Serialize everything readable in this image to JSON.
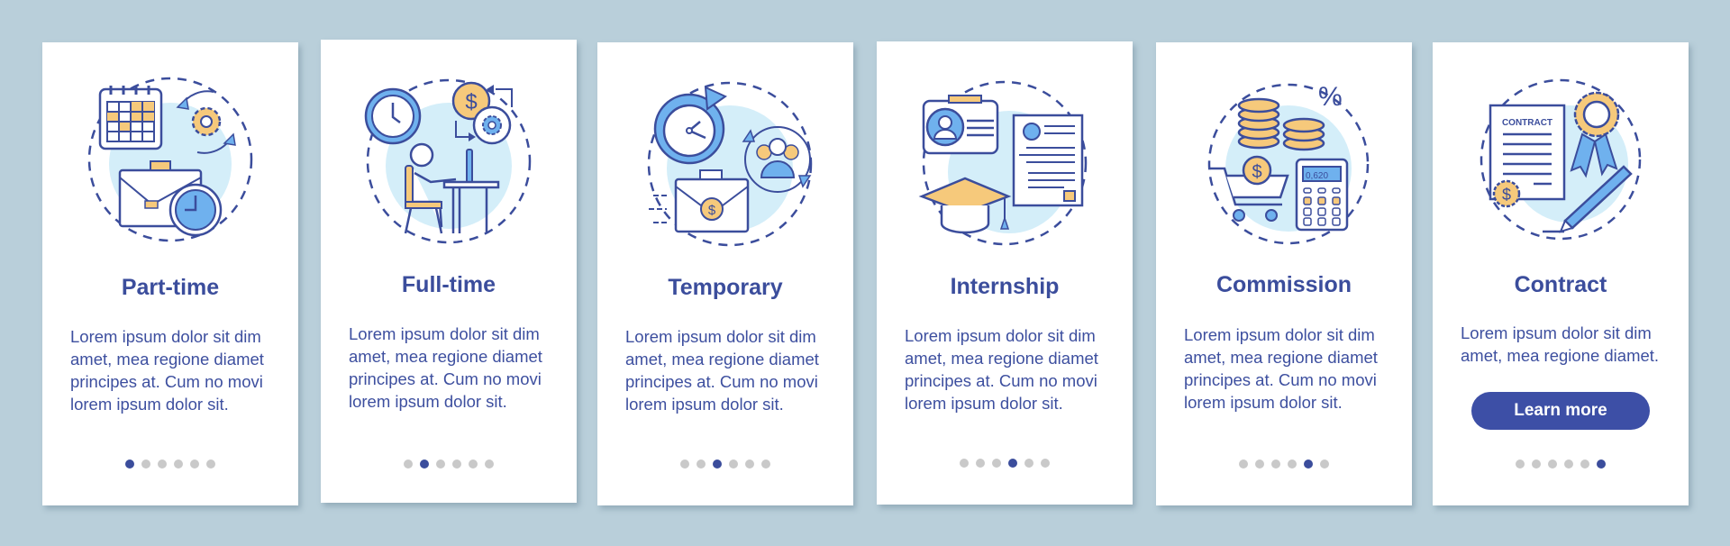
{
  "colors": {
    "background": "#b9cfda",
    "accent": "#3b4d9c",
    "light_blue": "#d4eef9",
    "icon_blue": "#6fb1ee",
    "icon_yellow": "#f6c97b",
    "dot_inactive": "#c9c9c9"
  },
  "cards": [
    {
      "title": "Part-time",
      "body": "Lorem ipsum dolor sit dim amet, mea regione diamet principes at. Cum no movi lorem ipsum dolor sit.",
      "icon": "part-time-illustration",
      "active_dot": 1
    },
    {
      "title": "Full-time",
      "body": "Lorem ipsum dolor sit dim amet, mea regione diamet principes at. Cum no movi lorem ipsum dolor sit.",
      "icon": "full-time-illustration",
      "active_dot": 2
    },
    {
      "title": "Temporary",
      "body": "Lorem ipsum dolor sit dim amet, mea regione diamet principes at. Cum no movi lorem ipsum dolor sit.",
      "icon": "temporary-illustration",
      "active_dot": 3
    },
    {
      "title": "Internship",
      "body": "Lorem ipsum dolor sit dim amet, mea regione diamet principes at. Cum no movi lorem ipsum dolor sit.",
      "icon": "internship-illustration",
      "active_dot": 4
    },
    {
      "title": "Commission",
      "body": "Lorem ipsum dolor sit dim amet, mea regione diamet principes at. Cum no movi lorem ipsum dolor sit.",
      "icon": "commission-illustration",
      "active_dot": 5,
      "calculator_display": "0,620",
      "percent_symbol": "%"
    },
    {
      "title": "Contract",
      "body": "Lorem ipsum dolor sit dim amet, mea regione diamet.",
      "icon": "contract-illustration",
      "active_dot": 6,
      "document_label": "CONTRACT",
      "button_label": "Learn more"
    }
  ],
  "pagination": {
    "total": 6
  },
  "currency_symbol": "$"
}
